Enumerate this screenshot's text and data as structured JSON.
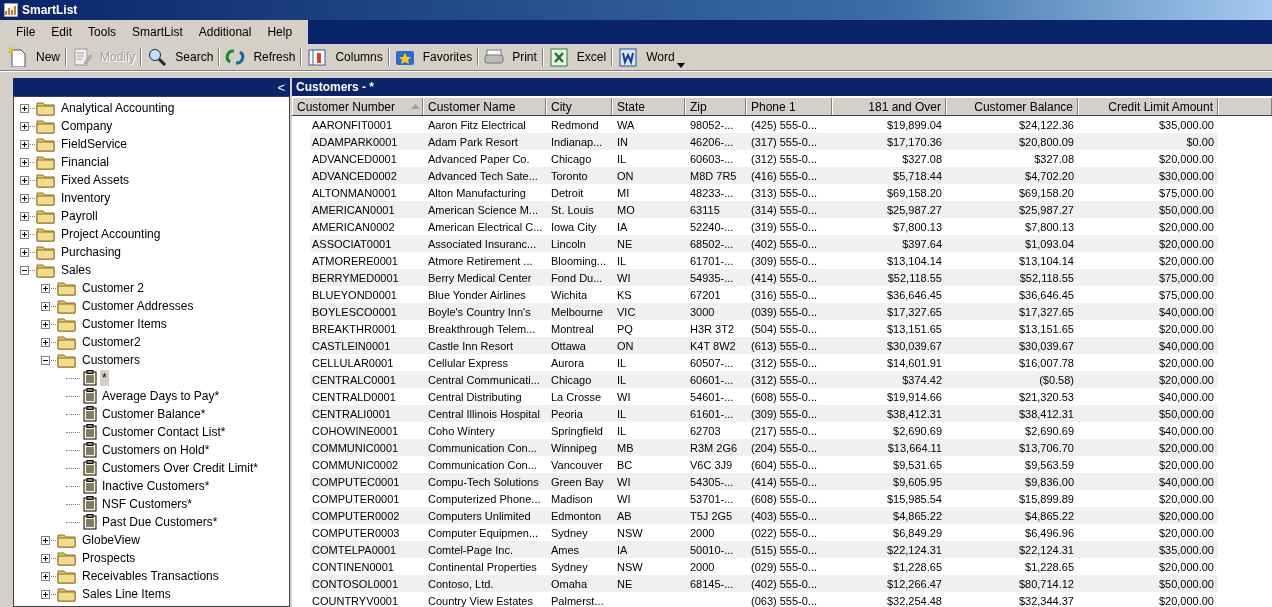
{
  "window": {
    "title": "SmartList"
  },
  "menu": [
    "File",
    "Edit",
    "Tools",
    "SmartList",
    "Additional",
    "Help"
  ],
  "toolbar": [
    {
      "label": "New",
      "kind": "new",
      "disabled": false,
      "dropdown": false
    },
    {
      "label": "Modify",
      "kind": "modify",
      "disabled": true,
      "dropdown": false
    },
    {
      "label": "Search",
      "kind": "search",
      "disabled": false,
      "dropdown": false
    },
    {
      "label": "Refresh",
      "kind": "refresh",
      "disabled": false,
      "dropdown": false
    },
    {
      "label": "Columns",
      "kind": "columns",
      "disabled": false,
      "dropdown": false
    },
    {
      "label": "Favorites",
      "kind": "favorites",
      "disabled": false,
      "dropdown": false
    },
    {
      "label": "Print",
      "kind": "print",
      "disabled": false,
      "dropdown": false
    },
    {
      "label": "Excel",
      "kind": "excel",
      "disabled": false,
      "dropdown": false
    },
    {
      "label": "Word",
      "kind": "word",
      "disabled": false,
      "dropdown": true
    }
  ],
  "tree_pane": {
    "collapse": "<",
    "items": [
      {
        "label": "Analytical Accounting",
        "kind": "folder",
        "expanded": false,
        "selected": false
      },
      {
        "label": "Company",
        "kind": "folder",
        "expanded": false,
        "selected": false
      },
      {
        "label": "FieldService",
        "kind": "folder",
        "expanded": false,
        "selected": false
      },
      {
        "label": "Financial",
        "kind": "folder",
        "expanded": false,
        "selected": false
      },
      {
        "label": "Fixed Assets",
        "kind": "folder",
        "expanded": false,
        "selected": false
      },
      {
        "label": "Inventory",
        "kind": "folder",
        "expanded": false,
        "selected": false
      },
      {
        "label": "Payroll",
        "kind": "folder",
        "expanded": false,
        "selected": false
      },
      {
        "label": "Project Accounting",
        "kind": "folder",
        "expanded": false,
        "selected": false
      },
      {
        "label": "Purchasing",
        "kind": "folder",
        "expanded": false,
        "selected": false
      },
      {
        "label": "Sales",
        "kind": "folder",
        "expanded": true,
        "selected": false,
        "children": [
          {
            "label": "Customer 2",
            "kind": "folder",
            "expanded": false,
            "selected": false
          },
          {
            "label": "Customer Addresses",
            "kind": "folder",
            "expanded": false,
            "selected": false
          },
          {
            "label": "Customer Items",
            "kind": "folder",
            "expanded": false,
            "selected": false
          },
          {
            "label": "Customer2",
            "kind": "folder",
            "expanded": false,
            "selected": false
          },
          {
            "label": "Customers",
            "kind": "folder",
            "expanded": true,
            "selected": false,
            "children": [
              {
                "label": "*",
                "kind": "list",
                "selected": true
              },
              {
                "label": "Average Days to Pay*",
                "kind": "list",
                "selected": false
              },
              {
                "label": "Customer Balance*",
                "kind": "list",
                "selected": false
              },
              {
                "label": "Customer Contact List*",
                "kind": "list",
                "selected": false
              },
              {
                "label": "Customers on Hold*",
                "kind": "list",
                "selected": false
              },
              {
                "label": "Customers Over Credit Limit*",
                "kind": "list",
                "selected": false
              },
              {
                "label": "Inactive Customers*",
                "kind": "list",
                "selected": false
              },
              {
                "label": "NSF Customers*",
                "kind": "list",
                "selected": false
              },
              {
                "label": "Past Due Customers*",
                "kind": "list",
                "selected": false
              }
            ]
          },
          {
            "label": "GlobeView",
            "kind": "folder",
            "expanded": false,
            "selected": false
          },
          {
            "label": "Prospects",
            "kind": "folder",
            "expanded": false,
            "selected": false
          },
          {
            "label": "Receivables Transactions",
            "kind": "folder",
            "expanded": false,
            "selected": false
          },
          {
            "label": "Sales Line Items",
            "kind": "folder",
            "expanded": false,
            "selected": false
          }
        ]
      }
    ]
  },
  "results": {
    "title": "Customers - *",
    "columns": [
      {
        "label": "Customer Number",
        "sorted": true
      },
      {
        "label": "Customer Name",
        "sorted": false
      },
      {
        "label": "City",
        "sorted": false
      },
      {
        "label": "State",
        "sorted": false
      },
      {
        "label": "Zip",
        "sorted": false
      },
      {
        "label": "Phone 1",
        "sorted": false
      },
      {
        "label": "181 and Over",
        "sorted": false
      },
      {
        "label": "Customer Balance",
        "sorted": false
      },
      {
        "label": "Credit Limit Amount",
        "sorted": false
      }
    ],
    "rows": [
      [
        "AARONFIT0001",
        "Aaron Fitz Electrical",
        "Redmond",
        "WA",
        "98052-...",
        "(425) 555-0...",
        "$19,899.04",
        "$24,122.36",
        "$35,000.00"
      ],
      [
        "ADAMPARK0001",
        "Adam Park Resort",
        "Indianap...",
        "IN",
        "46206-...",
        "(317) 555-0...",
        "$17,170.36",
        "$20,800.09",
        "$0.00"
      ],
      [
        "ADVANCED0001",
        "Advanced Paper Co.",
        "Chicago",
        "IL",
        "60603-...",
        "(312) 555-0...",
        "$327.08",
        "$327.08",
        "$20,000.00"
      ],
      [
        "ADVANCED0002",
        "Advanced Tech Sate...",
        "Toronto",
        "ON",
        "M8D 7R5",
        "(416) 555-0...",
        "$5,718.44",
        "$4,702.20",
        "$30,000.00"
      ],
      [
        "ALTONMAN0001",
        "Alton Manufacturing",
        "Detroit",
        "MI",
        "48233-...",
        "(313) 555-0...",
        "$69,158.20",
        "$69,158.20",
        "$75,000.00"
      ],
      [
        "AMERICAN0001",
        "American Science M...",
        "St. Louis",
        "MO",
        "63115",
        "(314) 555-0...",
        "$25,987.27",
        "$25,987.27",
        "$50,000.00"
      ],
      [
        "AMERICAN0002",
        "American Electrical C...",
        "Iowa City",
        "IA",
        "52240-...",
        "(319) 555-0...",
        "$7,800.13",
        "$7,800.13",
        "$20,000.00"
      ],
      [
        "ASSOCIAT0001",
        "Associated Insuranc...",
        "Lincoln",
        "NE",
        "68502-...",
        "(402) 555-0...",
        "$397.64",
        "$1,093.04",
        "$20,000.00"
      ],
      [
        "ATMORERE0001",
        "Atmore Retirement ...",
        "Blooming...",
        "IL",
        "61701-...",
        "(309) 555-0...",
        "$13,104.14",
        "$13,104.14",
        "$20,000.00"
      ],
      [
        "BERRYMED0001",
        "Berry Medical Center",
        "Fond Du...",
        "WI",
        "54935-...",
        "(414) 555-0...",
        "$52,118.55",
        "$52,118.55",
        "$75,000.00"
      ],
      [
        "BLUEYOND0001",
        "Blue Yonder Airlines",
        "Wichita",
        "KS",
        "67201",
        "(316) 555-0...",
        "$36,646.45",
        "$36,646.45",
        "$75,000.00"
      ],
      [
        "BOYLESCO0001",
        "Boyle's Country Inn's",
        "Melbourne",
        "VIC",
        "3000",
        "(039) 555-0...",
        "$17,327.65",
        "$17,327.65",
        "$40,000.00"
      ],
      [
        "BREAKTHR0001",
        "Breakthrough Telem...",
        "Montreal",
        "PQ",
        "H3R 3T2",
        "(504) 555-0...",
        "$13,151.65",
        "$13,151.65",
        "$20,000.00"
      ],
      [
        "CASTLEIN0001",
        "Castle Inn Resort",
        "Ottawa",
        "ON",
        "K4T 8W2",
        "(613) 555-0...",
        "$30,039.67",
        "$30,039.67",
        "$40,000.00"
      ],
      [
        "CELLULAR0001",
        "Cellular Express",
        "Aurora",
        "IL",
        "60507-...",
        "(312) 555-0...",
        "$14,601.91",
        "$16,007.78",
        "$20,000.00"
      ],
      [
        "CENTRALC0001",
        "Central Communicati...",
        "Chicago",
        "IL",
        "60601-...",
        "(312) 555-0...",
        "$374.42",
        "($0.58)",
        "$20,000.00"
      ],
      [
        "CENTRALD0001",
        "Central Distributing",
        "La Crosse",
        "WI",
        "54601-...",
        "(608) 555-0...",
        "$19,914.66",
        "$21,320.53",
        "$40,000.00"
      ],
      [
        "CENTRALI0001",
        "Central Illinois Hospital",
        "Peoria",
        "IL",
        "61601-...",
        "(309) 555-0...",
        "$38,412.31",
        "$38,412.31",
        "$50,000.00"
      ],
      [
        "COHOWINE0001",
        "Coho Wintery",
        "Springfield",
        "IL",
        "62703",
        "(217) 555-0...",
        "$2,690.69",
        "$2,690.69",
        "$40,000.00"
      ],
      [
        "COMMUNIC0001",
        "Communication Con...",
        "Winnipeg",
        "MB",
        "R3M 2G6",
        "(204) 555-0...",
        "$13,664.11",
        "$13,706.70",
        "$20,000.00"
      ],
      [
        "COMMUNIC0002",
        "Communication Con...",
        "Vancouver",
        "BC",
        "V6C 3J9",
        "(604) 555-0...",
        "$9,531.65",
        "$9,563.59",
        "$20,000.00"
      ],
      [
        "COMPUTEC0001",
        "Compu-Tech Solutions",
        "Green Bay",
        "WI",
        "54305-...",
        "(414) 555-0...",
        "$9,605.95",
        "$9,836.00",
        "$40,000.00"
      ],
      [
        "COMPUTER0001",
        "Computerized Phone...",
        "Madison",
        "WI",
        "53701-...",
        "(608) 555-0...",
        "$15,985.54",
        "$15,899.89",
        "$20,000.00"
      ],
      [
        "COMPUTER0002",
        "Computers Unlimited",
        "Edmonton",
        "AB",
        "T5J 2G5",
        "(403) 555-0...",
        "$4,865.22",
        "$4,865.22",
        "$20,000.00"
      ],
      [
        "COMPUTER0003",
        "Computer Equipmen...",
        "Sydney",
        "NSW",
        "2000",
        "(022) 555-0...",
        "$6,849.29",
        "$6,496.96",
        "$20,000.00"
      ],
      [
        "COMTELPA0001",
        "Comtel-Page Inc.",
        "Ames",
        "IA",
        "50010-...",
        "(515) 555-0...",
        "$22,124.31",
        "$22,124.31",
        "$35,000.00"
      ],
      [
        "CONTINEN0001",
        "Continental Properties",
        "Sydney",
        "NSW",
        "2000",
        "(029) 555-0...",
        "$1,228.65",
        "$1,228.65",
        "$20,000.00"
      ],
      [
        "CONTOSOL0001",
        "Contoso, Ltd.",
        "Omaha",
        "NE",
        "68145-...",
        "(402) 555-0...",
        "$12,266.47",
        "$80,714.12",
        "$50,000.00"
      ],
      [
        "COUNTRYV0001",
        "Country View Estates",
        "Palmerst...",
        "",
        "",
        "(063) 555-0...",
        "$32,254.48",
        "$32,344.37",
        "$20,000.00"
      ]
    ]
  }
}
